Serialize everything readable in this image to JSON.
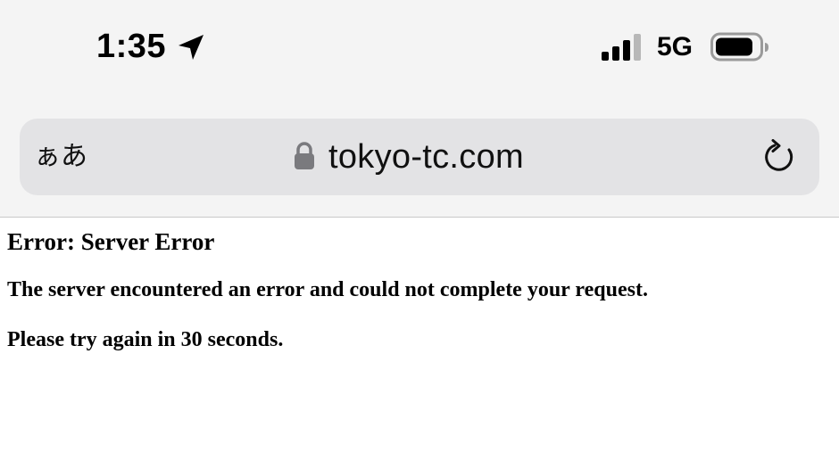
{
  "status_bar": {
    "time": "1:35",
    "network": "5G",
    "icons": [
      "location-arrow-icon",
      "cellular-signal-icon",
      "battery-icon"
    ]
  },
  "browser": {
    "text_size_button": "ぁあ",
    "url": "tokyo-tc.com",
    "icons": [
      "lock-icon",
      "reload-icon"
    ]
  },
  "page": {
    "title": "Error: Server Error",
    "message": "The server encountered an error and could not complete your request.",
    "retry": "Please try again in 30 seconds."
  },
  "colors": {
    "chrome_background": "#f4f4f4",
    "address_bar": "#e3e3e5",
    "page_background": "#ffffff",
    "text": "#000000",
    "lock": "#7a7a7e"
  }
}
